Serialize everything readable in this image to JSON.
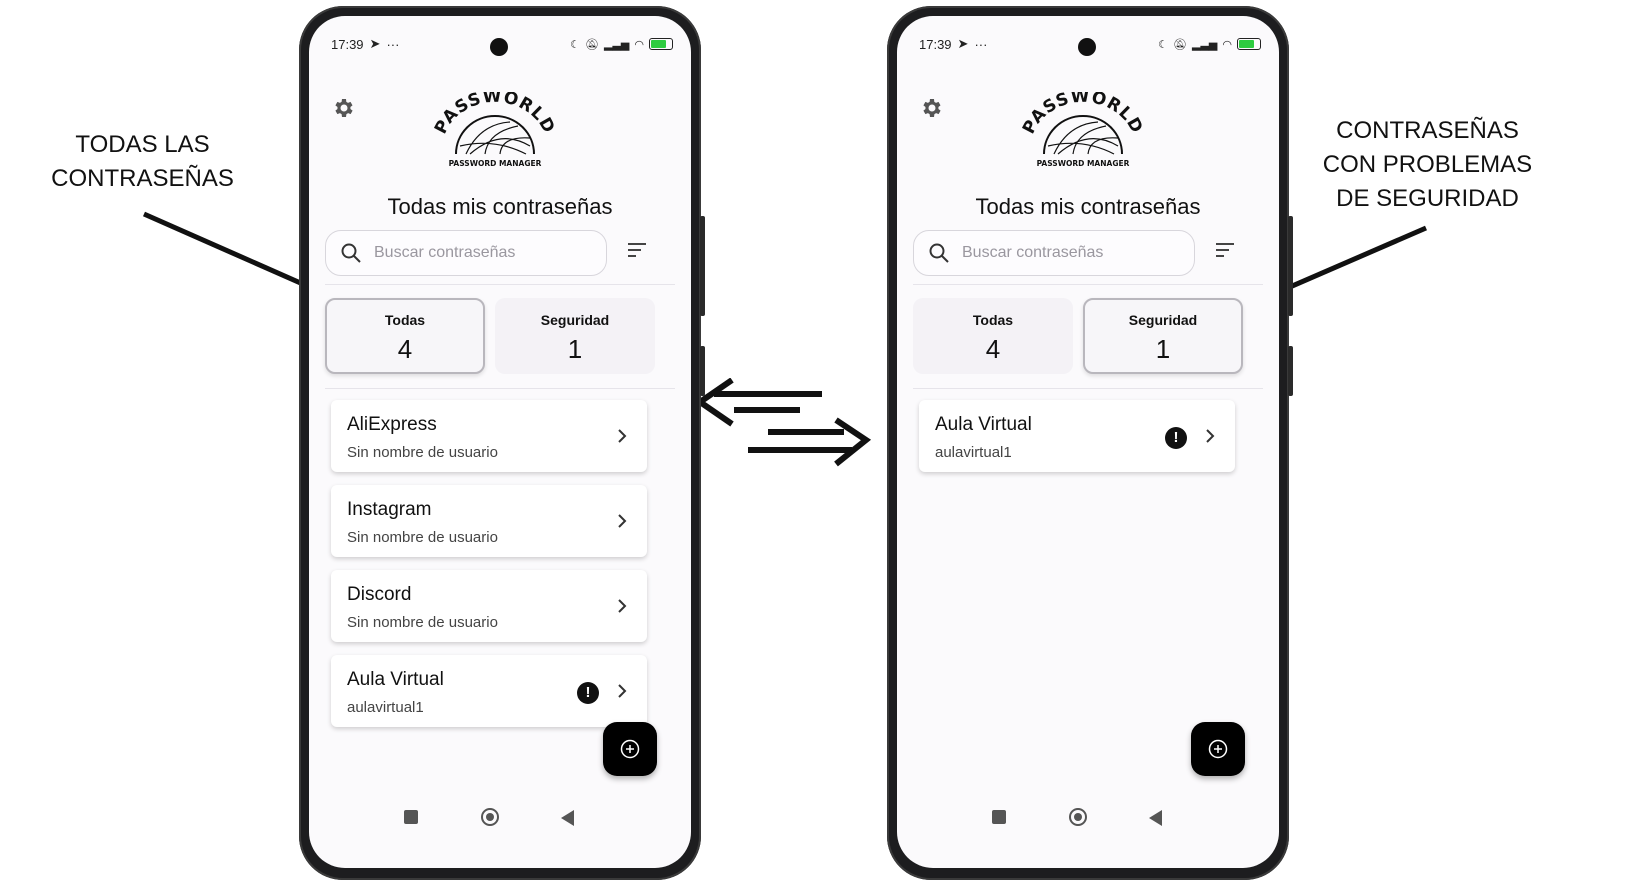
{
  "captions": {
    "left": [
      "TODAS LAS",
      "CONTRASEÑAS"
    ],
    "right": [
      "CONTRASEÑAS",
      "CON PROBLEMAS",
      "DE SEGURIDAD"
    ]
  },
  "phones": [
    {
      "status": {
        "time": "17:39"
      },
      "logo": {
        "brand": "PASSWORLD",
        "tagline": "PASSWORD MANAGER"
      },
      "title": "Todas mis contraseñas",
      "search_placeholder": "Buscar contraseñas",
      "tabs": [
        {
          "label": "Todas",
          "count": "4",
          "active": true
        },
        {
          "label": "Seguridad",
          "count": "1",
          "active": false
        }
      ],
      "items": [
        {
          "name": "AliExpress",
          "user": "Sin nombre de usuario",
          "warning": false
        },
        {
          "name": "Instagram",
          "user": "Sin nombre de usuario",
          "warning": false
        },
        {
          "name": "Discord",
          "user": "Sin nombre de usuario",
          "warning": false
        },
        {
          "name": "Aula Virtual",
          "user": "aulavirtual1",
          "warning": true
        }
      ]
    },
    {
      "status": {
        "time": "17:39"
      },
      "logo": {
        "brand": "PASSWORLD",
        "tagline": "PASSWORD MANAGER"
      },
      "title": "Todas mis contraseñas",
      "search_placeholder": "Buscar contraseñas",
      "tabs": [
        {
          "label": "Todas",
          "count": "4",
          "active": false
        },
        {
          "label": "Seguridad",
          "count": "1",
          "active": true
        }
      ],
      "items": [
        {
          "name": "Aula Virtual",
          "user": "aulavirtual1",
          "warning": true
        }
      ]
    }
  ],
  "warning_glyph": "!",
  "icons": [
    "gear-icon",
    "search-icon",
    "filter-icon",
    "chevron-right-icon",
    "warning-icon",
    "add-icon",
    "swap-arrows-icon"
  ]
}
